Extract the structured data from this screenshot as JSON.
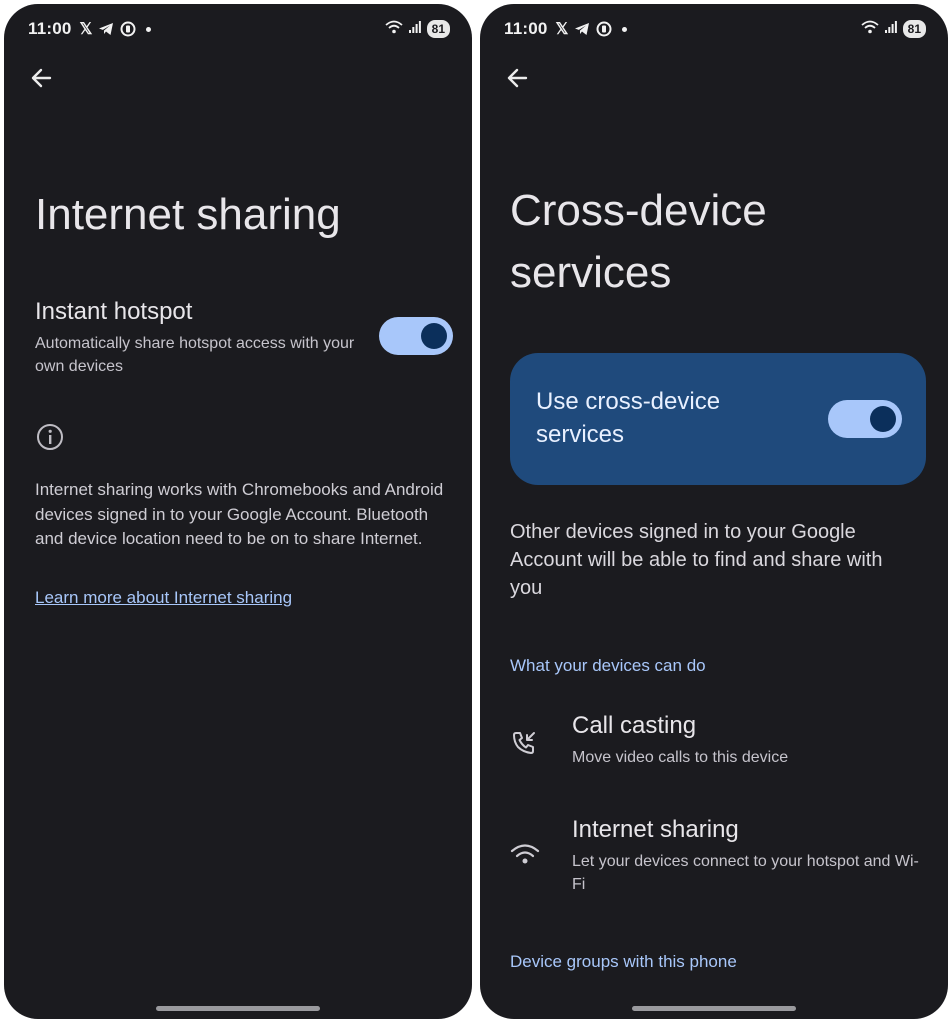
{
  "status_bar": {
    "time": "11:00",
    "battery": "81"
  },
  "left_screen": {
    "title": "Internet sharing",
    "instant_hotspot": {
      "title": "Instant hotspot",
      "subtitle": "Automatically share hotspot access with your own devices",
      "enabled": true
    },
    "info_text": "Internet sharing works with Chromebooks and Android devices signed in to your Google Account. Bluetooth and device location need to be on to share Internet.",
    "learn_more_link": "Learn more about Internet sharing"
  },
  "right_screen": {
    "title": "Cross-device services",
    "main_toggle": {
      "label": "Use cross-device services",
      "enabled": true
    },
    "description": "Other devices signed in to your Google Account will be able to find and share with you",
    "section_devices": "What your devices can do",
    "features": [
      {
        "icon": "call-casting-icon",
        "title": "Call casting",
        "subtitle": "Move video calls to this device"
      },
      {
        "icon": "wifi-icon",
        "title": "Internet sharing",
        "subtitle": "Let your devices connect to your hotspot and Wi-Fi"
      }
    ],
    "section_groups": "Device groups with this phone"
  },
  "colors": {
    "background": "#1b1b1f",
    "accent": "#a8c7fa",
    "card": "#1f4a7c"
  }
}
